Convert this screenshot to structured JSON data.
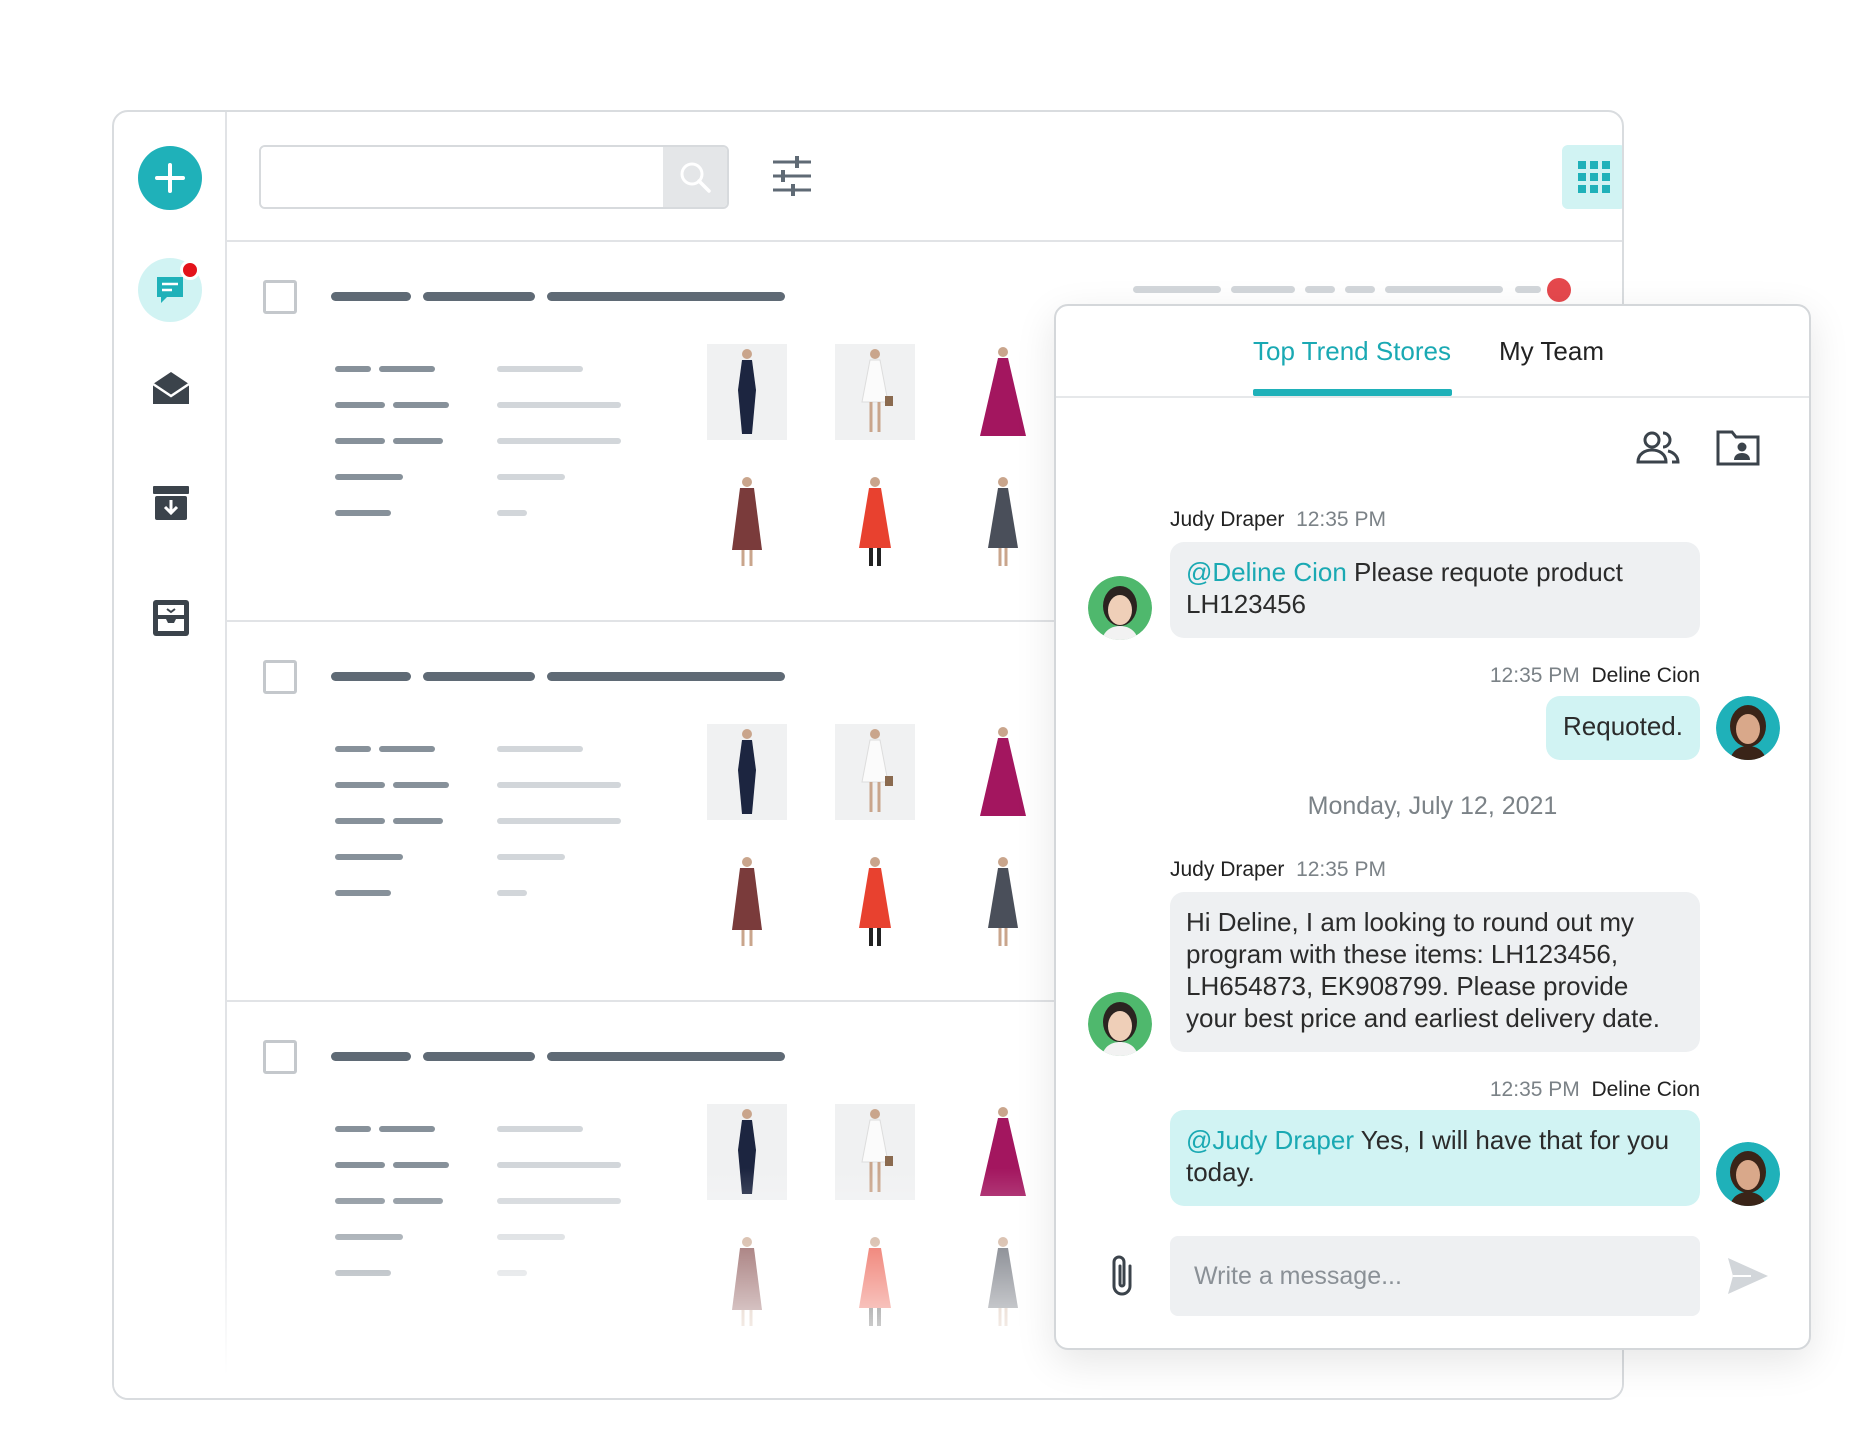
{
  "search": {
    "placeholder": ""
  },
  "chat": {
    "tabs": [
      {
        "label": "Top Trend Stores",
        "active": true
      },
      {
        "label": "My Team",
        "active": false
      }
    ],
    "messages": [
      {
        "sender": "Judy Draper",
        "time": "12:35 PM",
        "mention": "@Deline Cion",
        "text": " Please requote product LH123456",
        "side": "left"
      },
      {
        "sender": "Deline Cion",
        "time": "12:35 PM",
        "mention": "",
        "text": "Requoted.",
        "side": "right"
      },
      {
        "sender": "Judy Draper",
        "time": "12:35 PM",
        "mention": "",
        "text": "Hi Deline, I am looking to round out my program with these items: LH123456, LH654873, EK908799. Please provide your best price and earliest delivery date.",
        "side": "left"
      },
      {
        "sender": "Deline Cion",
        "time": "12:35 PM",
        "mention": "@Judy Draper",
        "text": " Yes, I will have that for you today.",
        "side": "right"
      }
    ],
    "date_separator": "Monday, July 12, 2021",
    "compose_placeholder": "Write a message..."
  },
  "colors": {
    "accent": "#1fb1b9",
    "accent_light": "#d1f3f3",
    "notification": "#e3131b"
  },
  "icons": [
    "plus-icon",
    "chat-icon",
    "mail-open-icon",
    "archive-icon",
    "inbox-icon",
    "search-icon",
    "filter-icon",
    "grid-icon",
    "list-icon",
    "team-icon",
    "folder-contact-icon",
    "paperclip-icon",
    "send-icon"
  ]
}
